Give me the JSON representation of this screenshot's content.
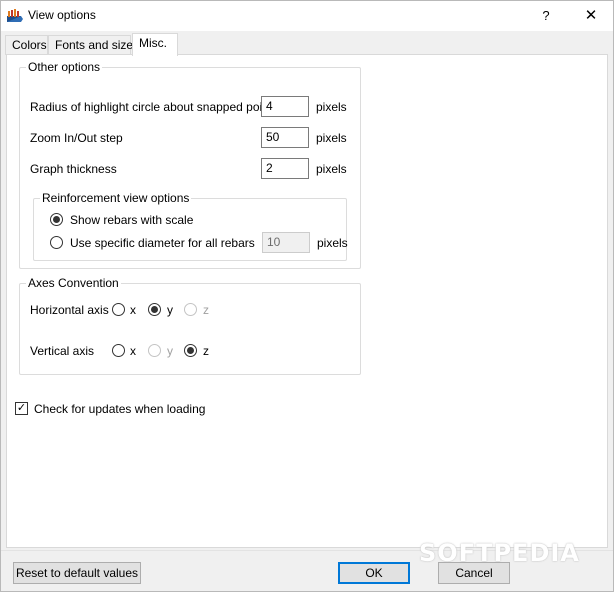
{
  "window": {
    "title": "View options",
    "help_glyph": "?",
    "close_glyph": "✕",
    "icon_name": "app-icon"
  },
  "tabs": [
    {
      "label": "Colors",
      "active": false
    },
    {
      "label": "Fonts and sizes",
      "active": false
    },
    {
      "label": "Misc.",
      "active": true
    }
  ],
  "other_options": {
    "title": "Other options",
    "rows": [
      {
        "label": "Radius of highlight circle about snapped points",
        "value": "4",
        "unit": "pixels"
      },
      {
        "label": "Zoom In/Out step",
        "value": "50",
        "unit": "pixels"
      },
      {
        "label": "Graph thickness",
        "value": "2",
        "unit": "pixels"
      }
    ],
    "reinforcement": {
      "title": "Reinforcement view options",
      "option_scale": "Show rebars with scale",
      "option_specific": "Use specific diameter for all rebars",
      "selected": "scale",
      "diameter_value": "10",
      "diameter_unit": "pixels"
    }
  },
  "axes": {
    "title": "Axes Convention",
    "horizontal": {
      "label": "Horizontal axis",
      "x": "x",
      "y": "y",
      "z": "z",
      "selected": "y"
    },
    "vertical": {
      "label": "Vertical axis",
      "x": "x",
      "y": "y",
      "z": "z",
      "selected": "z"
    }
  },
  "updates": {
    "label": "Check for updates when loading",
    "checked": true,
    "check_glyph": "✓"
  },
  "buttons": {
    "reset": "Reset to default values",
    "ok": "OK",
    "cancel": "Cancel"
  },
  "watermark": "SOFTPEDIA",
  "colors": {
    "accent": "#0078d7",
    "panel": "#ffffff",
    "chrome": "#f0f0f0"
  }
}
